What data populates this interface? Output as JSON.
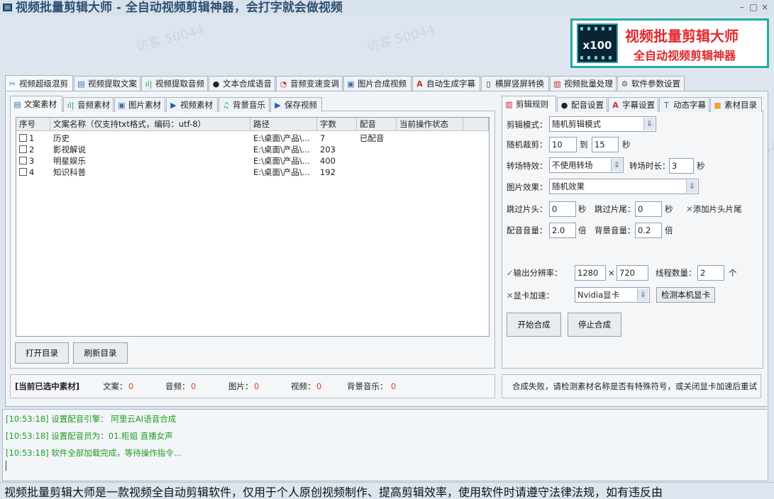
{
  "window": {
    "title": "视频批量剪辑大师 - 全自动视频剪辑神器，会打字就会做视频",
    "controls": {
      "minimize": "–",
      "maximize": "□",
      "close": "×"
    }
  },
  "banner": {
    "badge": "x100",
    "title": "视频批量剪辑大师",
    "subtitle": "全自动视频剪辑神器"
  },
  "watermark": "访客 50044",
  "main_tabs": [
    {
      "label": "视频超级混剪",
      "icon": "scissors-icon",
      "active": true
    },
    {
      "label": "视频提取文案",
      "icon": "document-icon"
    },
    {
      "label": "视频提取音频",
      "icon": "audio-wave-icon"
    },
    {
      "label": "文本合成语音",
      "icon": "microphone-icon"
    },
    {
      "label": "音频变速变调",
      "icon": "gauge-icon"
    },
    {
      "label": "图片合成视频",
      "icon": "image-icon"
    },
    {
      "label": "自动生成字幕",
      "icon": "font-icon"
    },
    {
      "label": "横屏竖屏转换",
      "icon": "rotate-screen-icon"
    },
    {
      "label": "视频批量处理",
      "icon": "film-icon"
    },
    {
      "label": "软件参数设置",
      "icon": "gear-icon"
    }
  ],
  "material_tabs": [
    {
      "label": "文案素材",
      "icon": "document-icon",
      "active": true
    },
    {
      "label": "音频素材",
      "icon": "audio-wave-icon"
    },
    {
      "label": "图片素材",
      "icon": "image-icon"
    },
    {
      "label": "视频素材",
      "icon": "play-icon"
    },
    {
      "label": "背景音乐",
      "icon": "music-note-icon"
    },
    {
      "label": "保存视频",
      "icon": "save-icon"
    }
  ],
  "table": {
    "headers": [
      "序号",
      "文案名称（仅支持txt格式，编码：utf-8）",
      "路径",
      "字数",
      "配音",
      "当前操作状态"
    ],
    "rows": [
      {
        "index": "1",
        "name": "历史",
        "path": "E:\\桌面\\产品\\...",
        "count": "7",
        "dub": "已配音",
        "status": ""
      },
      {
        "index": "2",
        "name": "影视解说",
        "path": "E:\\桌面\\产品\\...",
        "count": "203",
        "dub": "",
        "status": ""
      },
      {
        "index": "3",
        "name": "明星娱乐",
        "path": "E:\\桌面\\产品\\...",
        "count": "400",
        "dub": "",
        "status": ""
      },
      {
        "index": "4",
        "name": "知识科普",
        "path": "E:\\桌面\\产品\\...",
        "count": "192",
        "dub": "",
        "status": ""
      }
    ]
  },
  "buttons": {
    "open_dir": "打开目录",
    "refresh_dir": "刷新目录",
    "start": "开始合成",
    "stop": "停止合成",
    "detect_gpu": "检测本机显卡"
  },
  "selection": {
    "label": "[当前已选中素材]",
    "items": [
      {
        "label": "文案：",
        "value": "0"
      },
      {
        "label": "音频：",
        "value": "0"
      },
      {
        "label": "图片：",
        "value": "0"
      },
      {
        "label": "视频：",
        "value": "0"
      },
      {
        "label": "背景音乐：",
        "value": "0"
      }
    ]
  },
  "status_message": "合成失败，请检测素材名称是否有特殊符号，或关闭显卡加速后重试",
  "settings_tabs": [
    {
      "label": "剪辑规则",
      "icon": "film-icon",
      "active": true
    },
    {
      "label": "配音设置",
      "icon": "microphone-icon"
    },
    {
      "label": "字幕设置",
      "icon": "font-icon"
    },
    {
      "label": "动态字幕",
      "icon": "text-box-icon"
    },
    {
      "label": "素材目录",
      "icon": "folder-icon"
    }
  ],
  "settings": {
    "edit_mode_label": "剪辑模式：",
    "edit_mode": "随机剪辑模式",
    "random_cut_label": "随机裁剪：",
    "random_cut_from": "10",
    "to_label": "到",
    "random_cut_to": "15",
    "sec": "秒",
    "transition_label": "转场特效：",
    "transition": "不使用转场",
    "transition_dur_label": "转场时长：",
    "transition_dur": "3",
    "image_effect_label": "图片效果：",
    "image_effect": "随机效果",
    "skip_head_label": "跳过片头：",
    "skip_head": "0",
    "skip_tail_label": "跳过片尾：",
    "skip_tail": "0",
    "add_head_tail": "添加片头片尾",
    "dub_volume_label": "配音音量：",
    "dub_volume": "2.0",
    "times": "倍",
    "bgm_volume_label": "背景音量：",
    "bgm_volume": "0.2",
    "resolution_label": "输出分辨率：",
    "res_w": "1280",
    "x": "×",
    "res_h": "720",
    "threads_label": "线程数量：",
    "threads": "2",
    "unit": "个",
    "gpu_label": "显卡加速：",
    "gpu": "Nvidia显卡"
  },
  "logs": [
    "[10:53:18] 设置配音引擎： 阿里云AI语音合成",
    "[10:53:18] 设置配音员为：01.柜姐 直播女声",
    "[10:53:18] 软件全部加载完成，等待操作指令..."
  ],
  "footer": "视频批量剪辑大师是一款视频全自动剪辑软件，仅用于个人原创视频制作、提高剪辑效率，使用软件时请遵守法律法规，如有违反由"
}
